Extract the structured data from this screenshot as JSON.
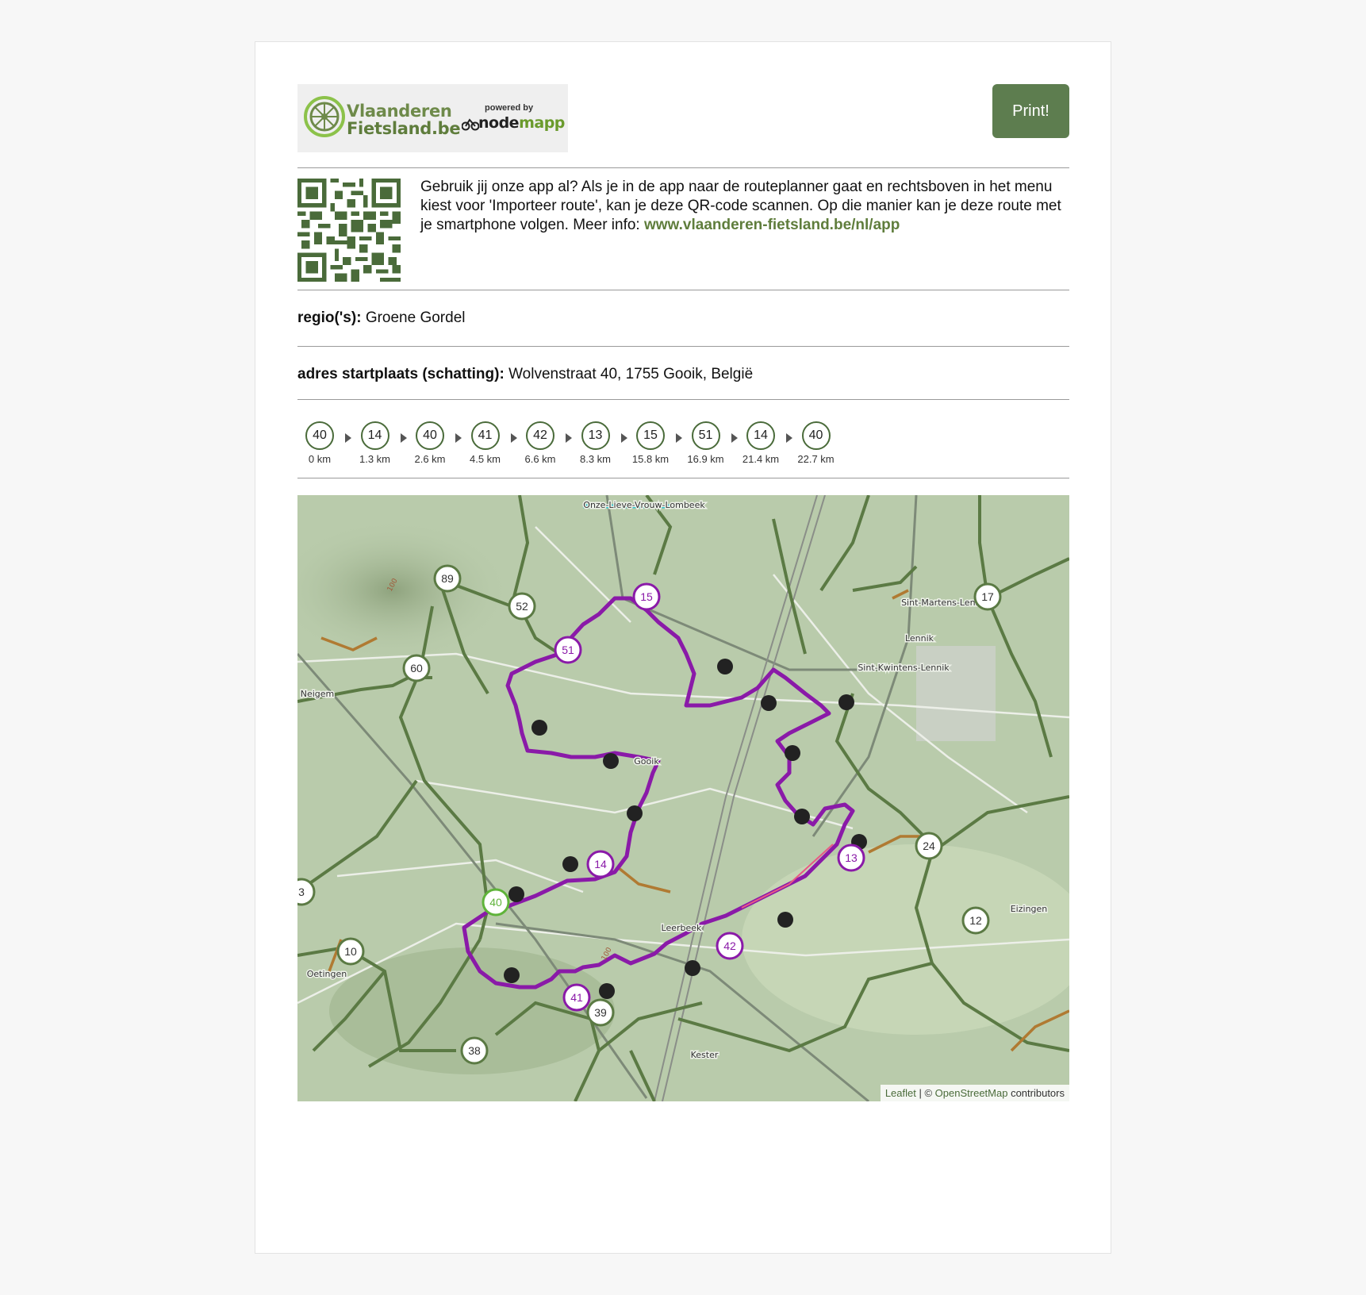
{
  "header": {
    "brand_line1": "Vlaanderen",
    "brand_line2": "Fietsland.be",
    "powered_by": "powered by",
    "powered_brand_a": "node",
    "powered_brand_b": "mapp",
    "print_label": "Print!"
  },
  "qr": {
    "text": "Gebruik jij onze app al? Als je in de app naar de routeplanner gaat en rechtsboven in het menu kiest voor 'Importeer route', kan je deze QR-code scannen. Op die manier kan je deze route met je smartphone volgen. Meer info: ",
    "link": "www.vlaanderen-fietsland.be/nl/app"
  },
  "region": {
    "label": "regio('s):",
    "value": "Groene Gordel"
  },
  "start": {
    "label": "adres startplaats (schatting):",
    "value": "Wolvenstraat 40, 1755 Gooik, België"
  },
  "route_nodes": [
    {
      "node": "40",
      "km": "0 km"
    },
    {
      "node": "14",
      "km": "1.3 km"
    },
    {
      "node": "40",
      "km": "2.6 km"
    },
    {
      "node": "41",
      "km": "4.5 km"
    },
    {
      "node": "42",
      "km": "6.6 km"
    },
    {
      "node": "13",
      "km": "8.3 km"
    },
    {
      "node": "15",
      "km": "15.8 km"
    },
    {
      "node": "51",
      "km": "16.9 km"
    },
    {
      "node": "14",
      "km": "21.4 km"
    },
    {
      "node": "40",
      "km": "22.7 km"
    }
  ],
  "map": {
    "place_labels": [
      "Onze-Lieve-Vrouw-Lombeek",
      "Sint-Martens-Lennik",
      "Lennik",
      "Sint-Kwintens-Lennik",
      "Neigem",
      "Gooik",
      "Leerbeek",
      "Oetingen",
      "Kester",
      "Eizingen"
    ],
    "elevation_labels": [
      "100",
      "100"
    ],
    "network_nodes": [
      "89",
      "52",
      "60",
      "17",
      "24",
      "12",
      "3",
      "10",
      "39",
      "38"
    ],
    "route_map_nodes": [
      "15",
      "51",
      "14",
      "13",
      "42",
      "41"
    ],
    "start_node": "40",
    "colors": {
      "route": "#8a1aa8",
      "network": "#5b7a44",
      "start": "#5fb33a",
      "base": "#b9cbab"
    }
  },
  "attribution": {
    "leaflet": "Leaflet",
    "sep": " | © ",
    "osm": "OpenStreetMap",
    "rest": " contributors"
  }
}
